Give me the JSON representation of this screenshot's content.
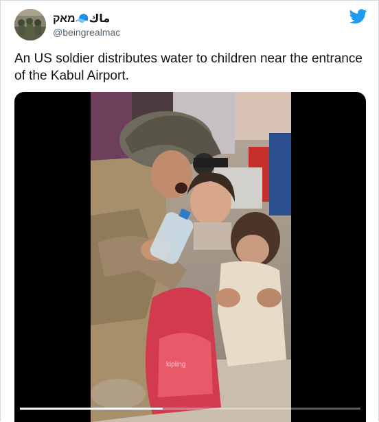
{
  "author": {
    "display_name": "ماك🧢מאק",
    "handle": "@beingrealmac"
  },
  "tweet": {
    "text": "An US soldier distributes water to children near the entrance of the Kabul Airport."
  },
  "media": {
    "type": "video",
    "progress": 0.42
  },
  "icons": {
    "brand": "twitter-bird-icon"
  },
  "colors": {
    "brand": "#1d9bf0",
    "text": "#0f1419",
    "secondary_text": "#536471",
    "border": "#cfd9de"
  }
}
